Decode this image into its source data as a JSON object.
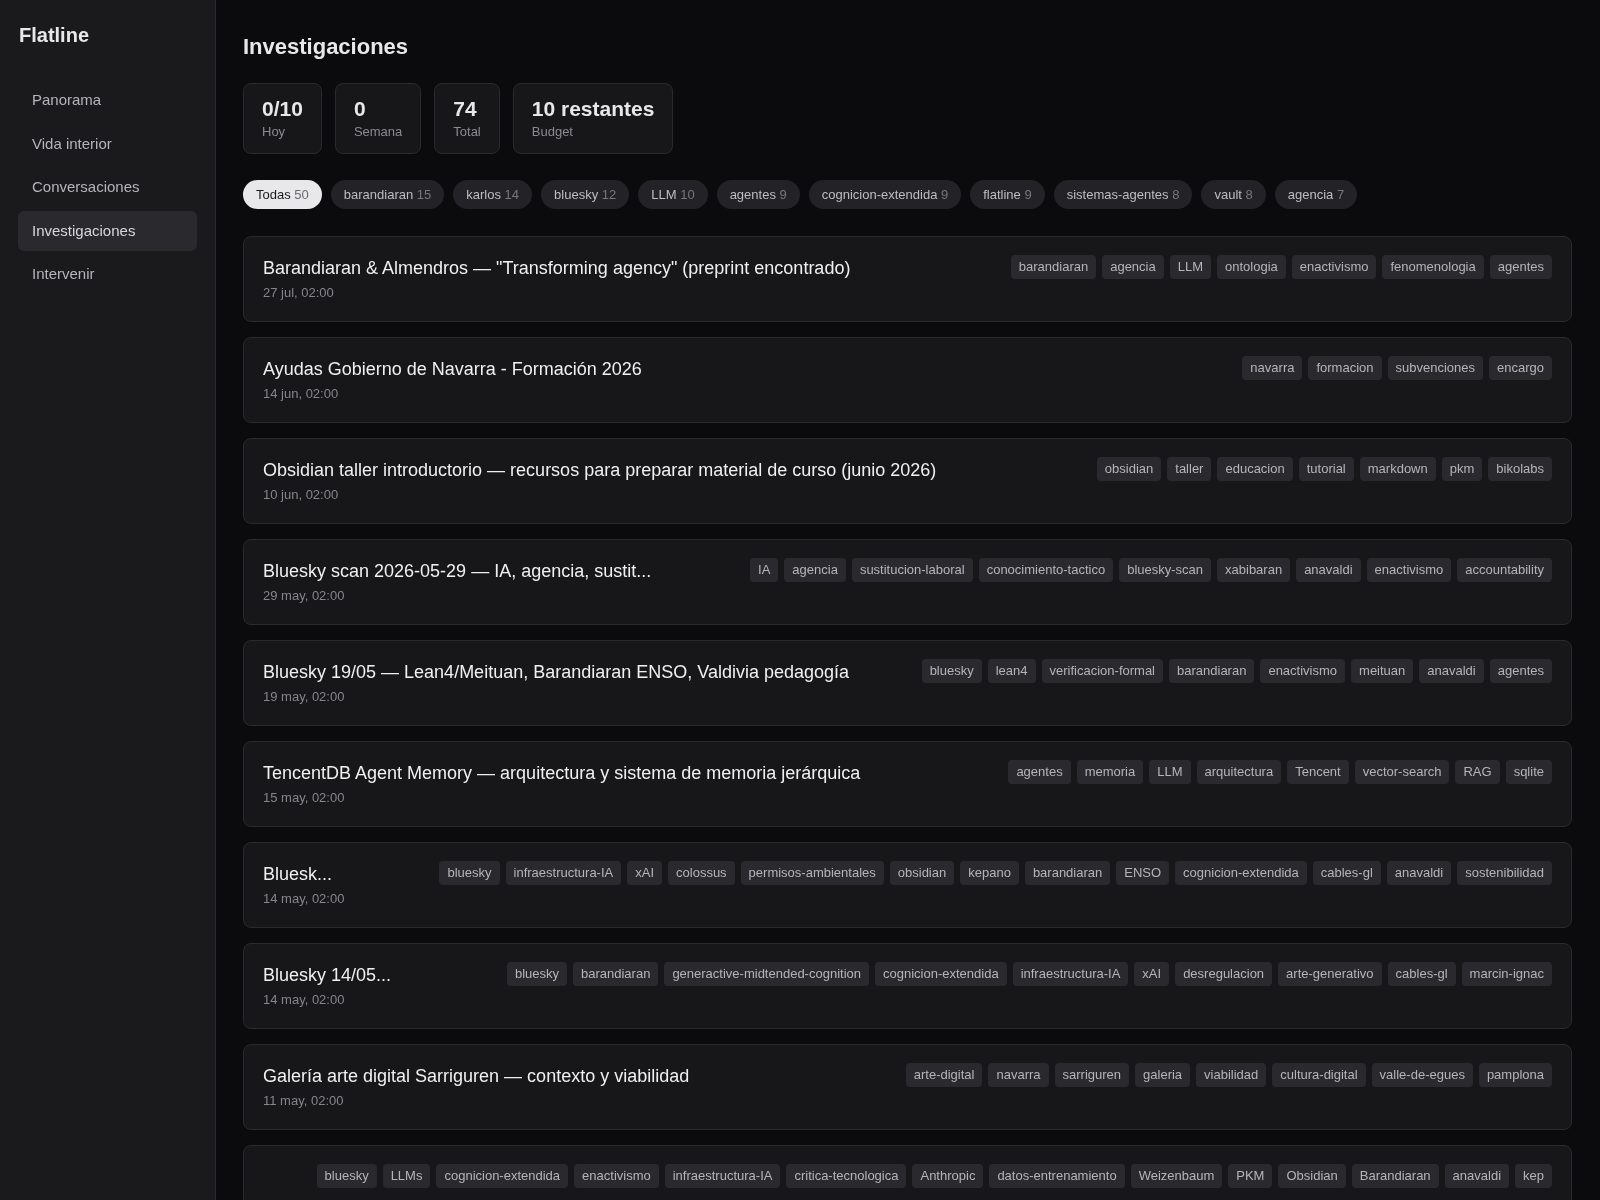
{
  "app": {
    "title": "Flatline"
  },
  "sidebar": {
    "items": [
      {
        "label": "Panorama",
        "selected": false
      },
      {
        "label": "Vida interior",
        "selected": false
      },
      {
        "label": "Conversaciones",
        "selected": false
      },
      {
        "label": "Investigaciones",
        "selected": true
      },
      {
        "label": "Intervenir",
        "selected": false
      }
    ]
  },
  "page": {
    "title": "Investigaciones"
  },
  "stats": [
    {
      "value": "0/10",
      "label": "Hoy"
    },
    {
      "value": "0",
      "label": "Semana"
    },
    {
      "value": "74",
      "label": "Total"
    },
    {
      "value": "10 restantes",
      "label": "Budget"
    }
  ],
  "filters": [
    {
      "label": "Todas",
      "count": "50",
      "selected": true
    },
    {
      "label": "barandiaran",
      "count": "15",
      "selected": false
    },
    {
      "label": "karlos",
      "count": "14",
      "selected": false
    },
    {
      "label": "bluesky",
      "count": "12",
      "selected": false
    },
    {
      "label": "LLM",
      "count": "10",
      "selected": false
    },
    {
      "label": "agentes",
      "count": "9",
      "selected": false
    },
    {
      "label": "cognicion-extendida",
      "count": "9",
      "selected": false
    },
    {
      "label": "flatline",
      "count": "9",
      "selected": false
    },
    {
      "label": "sistemas-agentes",
      "count": "8",
      "selected": false
    },
    {
      "label": "vault",
      "count": "8",
      "selected": false
    },
    {
      "label": "agencia",
      "count": "7",
      "selected": false
    }
  ],
  "items": [
    {
      "title": "Barandiaran & Almendros — \"Transforming agency\" (preprint encontrado)",
      "date": "27 jul, 02:00",
      "tags": [
        "barandiaran",
        "agencia",
        "LLM",
        "ontologia",
        "enactivismo",
        "fenomenologia",
        "agentes"
      ]
    },
    {
      "title": "Ayudas Gobierno de Navarra - Formación 2026",
      "date": "14 jun, 02:00",
      "tags": [
        "navarra",
        "formacion",
        "subvenciones",
        "encargo"
      ]
    },
    {
      "title": "Obsidian taller introductorio — recursos para preparar material de curso (junio 2026)",
      "date": "10 jun, 02:00",
      "tags": [
        "obsidian",
        "taller",
        "educacion",
        "tutorial",
        "markdown",
        "pkm",
        "bikolabs"
      ]
    },
    {
      "title": "Bluesky scan 2026-05-29 — IA, agencia, sustit...",
      "date": "29 may, 02:00",
      "tags": [
        "IA",
        "agencia",
        "sustitucion-laboral",
        "conocimiento-tactico",
        "bluesky-scan",
        "xabibaran",
        "anavaldi",
        "enactivismo",
        "accountability"
      ]
    },
    {
      "title": "Bluesky 19/05 — Lean4/Meituan, Barandiaran ENSO, Valdivia pedagogía",
      "date": "19 may, 02:00",
      "tags": [
        "bluesky",
        "lean4",
        "verificacion-formal",
        "barandiaran",
        "enactivismo",
        "meituan",
        "anavaldi",
        "agentes"
      ]
    },
    {
      "title": "TencentDB Agent Memory — arquitectura y sistema de memoria jerárquica",
      "date": "15 may, 02:00",
      "tags": [
        "agentes",
        "memoria",
        "LLM",
        "arquitectura",
        "Tencent",
        "vector-search",
        "RAG",
        "sqlite"
      ]
    },
    {
      "title": "Bluesk...",
      "date": "14 may, 02:00",
      "tags": [
        "bluesky",
        "infraestructura-IA",
        "xAI",
        "colossus",
        "permisos-ambientales",
        "obsidian",
        "kepano",
        "barandiaran",
        "ENSO",
        "cognicion-extendida",
        "cables-gl",
        "anavaldi",
        "sostenibilidad"
      ]
    },
    {
      "title": "Bluesky 14/05...",
      "date": "14 may, 02:00",
      "tags": [
        "bluesky",
        "barandiaran",
        "generactive-midtended-cognition",
        "cognicion-extendida",
        "infraestructura-IA",
        "xAI",
        "desregulacion",
        "arte-generativo",
        "cables-gl",
        "marcin-ignac"
      ]
    },
    {
      "title": "Galería arte digital Sarriguren — contexto y viabilidad",
      "date": "11 may, 02:00",
      "tags": [
        "arte-digital",
        "navarra",
        "sarriguren",
        "galeria",
        "viabilidad",
        "cultura-digital",
        "valle-de-egues",
        "pamplona"
      ]
    },
    {
      "tags": [
        "bluesky",
        "LLMs",
        "cognicion-extendida",
        "enactivismo",
        "infraestructura-IA",
        "critica-tecnologica",
        "Anthropic",
        "datos-entrenamiento",
        "Weizenbaum",
        "PKM",
        "Obsidian",
        "Barandiaran",
        "anavaldi",
        "kep"
      ]
    }
  ]
}
